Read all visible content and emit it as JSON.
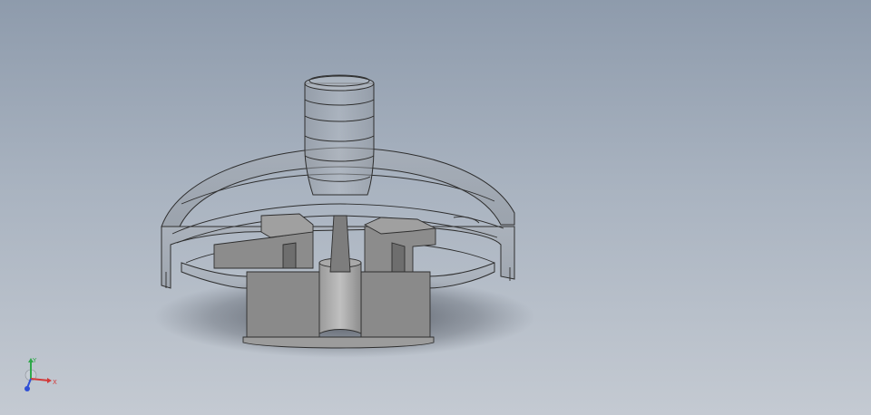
{
  "viewport": {
    "background_top": "#8e9bac",
    "background_bottom": "#c4cad2"
  },
  "model": {
    "render_mode": "section-view-transparent",
    "shell_color": "#8f9399",
    "impeller_color": "#8a8a8a",
    "edge_color": "#2e2e2e"
  },
  "triad": {
    "x_label": "X",
    "y_label": "Y",
    "x_color": "#d23a3a",
    "y_color": "#2fa84a",
    "z_color": "#2f4fd6"
  }
}
